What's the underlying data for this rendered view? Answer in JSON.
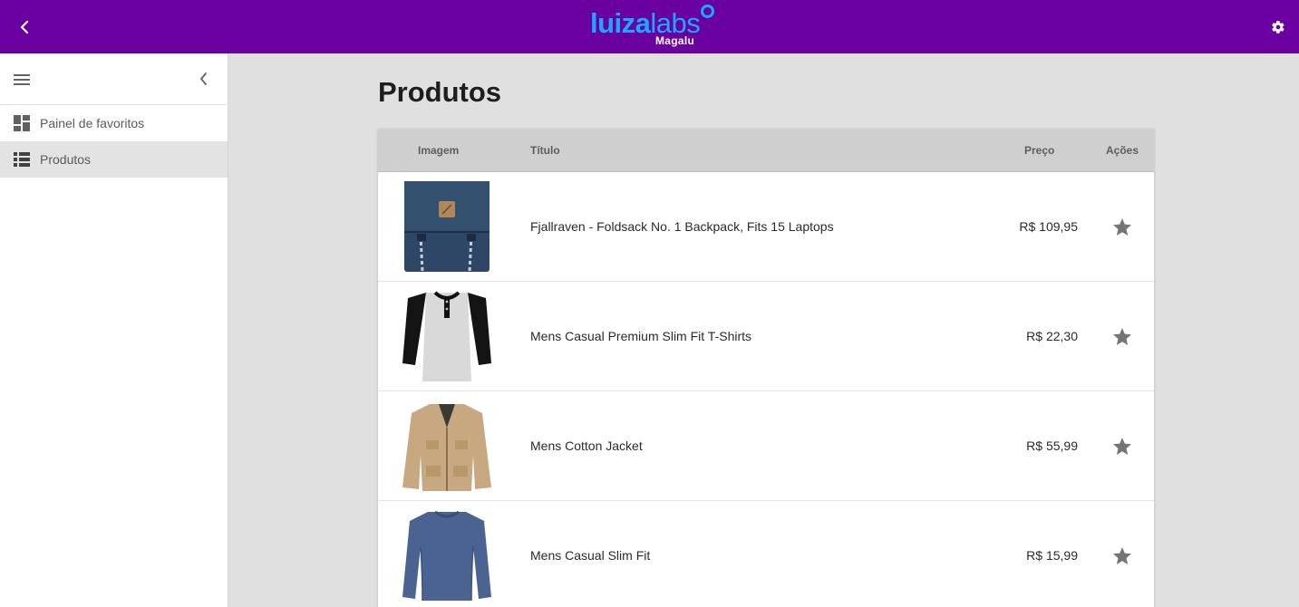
{
  "header": {
    "logo_bold": "luiza",
    "logo_light": "labs",
    "logo_sub": "Magalu"
  },
  "sidebar": {
    "items": [
      {
        "label": "Painel de favoritos",
        "icon": "dashboard-icon"
      },
      {
        "label": "Produtos",
        "icon": "list-icon",
        "active": true
      }
    ]
  },
  "main": {
    "title": "Produtos",
    "table": {
      "columns": [
        "Imagem",
        "Título",
        "Preço",
        "Ações"
      ],
      "rows": [
        {
          "image": "backpack-image",
          "title": "Fjallraven - Foldsack No. 1 Backpack, Fits 15 Laptops",
          "price": "R$ 109,95"
        },
        {
          "image": "tshirt-image",
          "title": "Mens Casual Premium Slim Fit T-Shirts",
          "price": "R$ 22,30"
        },
        {
          "image": "jacket-image",
          "title": "Mens Cotton Jacket",
          "price": "R$ 55,99"
        },
        {
          "image": "sweater-image",
          "title": "Mens Casual Slim Fit",
          "price": "R$ 15,99"
        }
      ]
    }
  },
  "colors": {
    "topbar": "#6a00a0",
    "logo_blue": "#1ba8ff",
    "star": "#757575"
  }
}
